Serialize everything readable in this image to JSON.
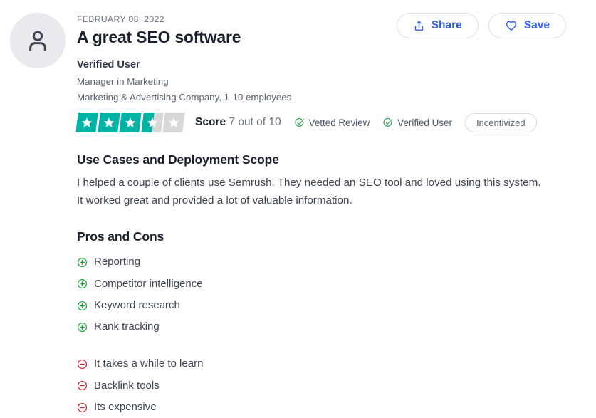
{
  "review": {
    "date": "FEBRUARY 08, 2022",
    "title": "A great SEO software",
    "reviewer_name": "Verified User",
    "reviewer_role": "Manager in Marketing",
    "reviewer_company": "Marketing & Advertising Company, 1-10 employees",
    "avatar_icon": "person-icon"
  },
  "actions": {
    "share_label": "Share",
    "share_icon": "share-icon",
    "save_label": "Save",
    "save_icon": "heart-icon",
    "accent_color": "#2f5ff4"
  },
  "rating": {
    "score_label": "Score",
    "score_text": "7 out of 10",
    "score_value": 7,
    "score_max": 10,
    "stars_filled": 3.5,
    "stars_total": 5,
    "star_color": "#00b3a4",
    "star_empty_color": "#d8d8d8",
    "badges": [
      {
        "label": "Vetted Review",
        "icon": "check-circle-icon",
        "color": "#2ea84f"
      },
      {
        "label": "Verified User",
        "icon": "check-circle-icon",
        "color": "#2ea84f"
      }
    ],
    "pill_label": "Incentivized"
  },
  "sections": [
    {
      "heading": "Use Cases and Deployment Scope",
      "body": "I helped a couple of clients use Semrush. They needed an SEO tool and loved using this system. It worked great and provided a lot of valuable information."
    }
  ],
  "pros_cons": {
    "heading": "Pros and Cons",
    "pro_icon": "plus-circle-icon",
    "pro_color": "#21a33c",
    "con_icon": "minus-circle-icon",
    "con_color": "#c8232c",
    "pros": [
      "Reporting",
      "Competitor intelligence",
      "Keyword research",
      "Rank tracking"
    ],
    "cons": [
      "It takes a while to learn",
      "Backlink tools",
      "Its expensive"
    ]
  }
}
